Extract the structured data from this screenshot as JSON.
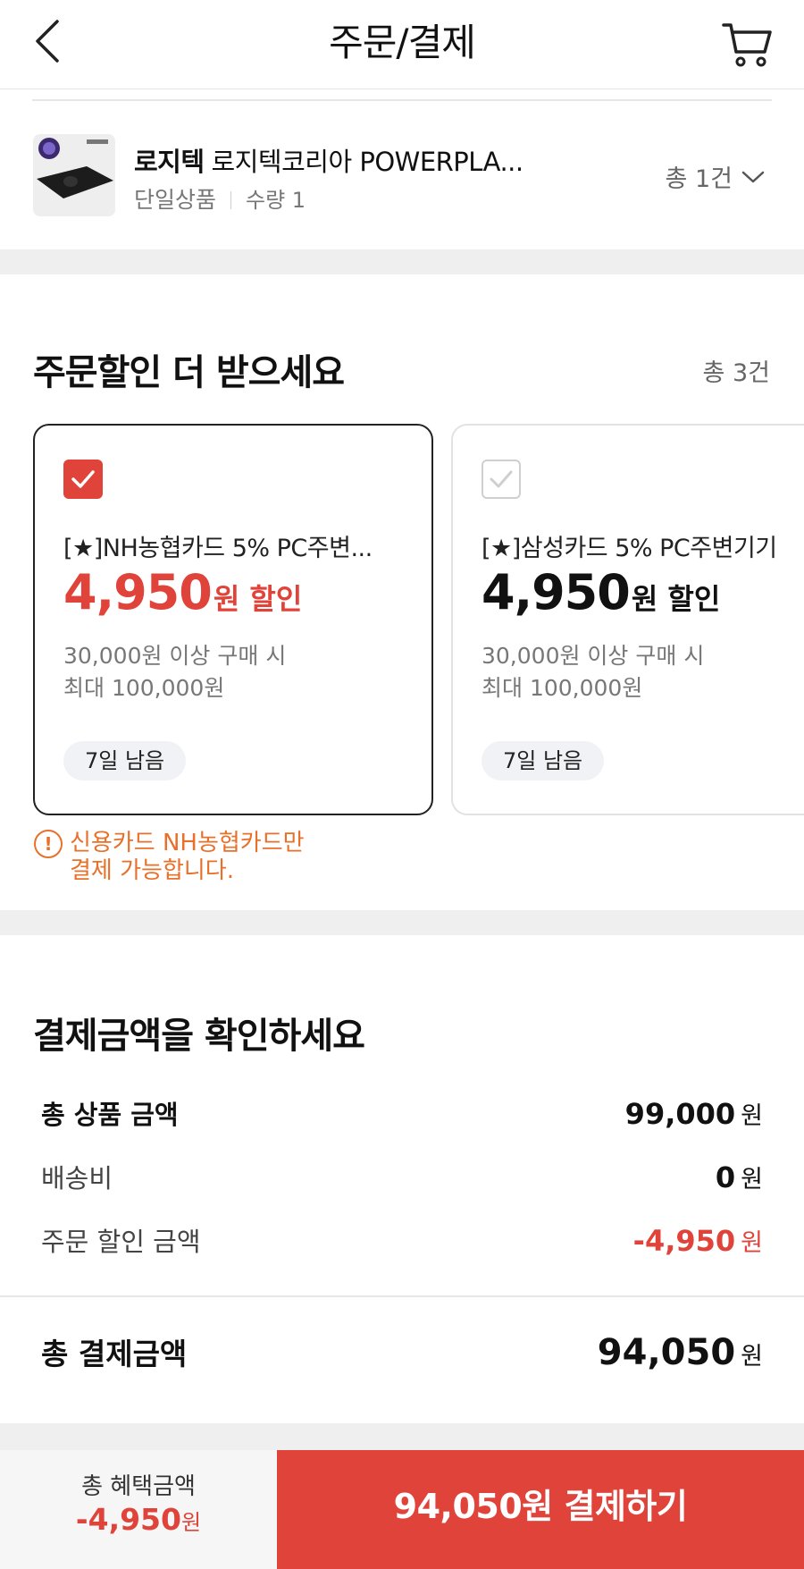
{
  "header": {
    "title": "주문/결제"
  },
  "product": {
    "brand": "로지텍",
    "name": "로지텍코리아 POWERPLA...",
    "option": "단일상품",
    "quantity": "수량 1",
    "total_count": "총 1건"
  },
  "discounts": {
    "title": "주문할인 더 받으세요",
    "count": "총 3건",
    "cards": [
      {
        "name": "[★]NH농협카드 5% PC주변...",
        "amount": "4,950",
        "unit": "원 할인",
        "condition1": "30,000원 이상 구매 시",
        "condition2": "최대 100,000원",
        "remaining": "7일 남음",
        "selected": true
      },
      {
        "name": "[★]삼성카드 5% PC주변기기",
        "amount": "4,950",
        "unit": "원 할인",
        "condition1": "30,000원 이상 구매 시",
        "condition2": "최대 100,000원",
        "remaining": "7일 남음",
        "selected": false
      }
    ],
    "notice_line1": "신용카드 NH농협카드만",
    "notice_line2": "결제 가능합니다."
  },
  "summary": {
    "title": "결제금액을 확인하세요",
    "product_total_label": "총 상품 금액",
    "product_total_value": "99,000",
    "shipping_label": "배송비",
    "shipping_value": "0",
    "discount_label": "주문 할인 금액",
    "discount_value": "-4,950",
    "currency": "원",
    "grand_total_label": "총 결제금액",
    "grand_total_value": "94,050"
  },
  "bottom_bar": {
    "benefit_label": "총 혜택금액",
    "benefit_value": "-4,950",
    "benefit_unit": "원",
    "pay_button": "94,050원 결제하기"
  },
  "colors": {
    "accent": "#e0433a",
    "warning": "#e8702a"
  }
}
